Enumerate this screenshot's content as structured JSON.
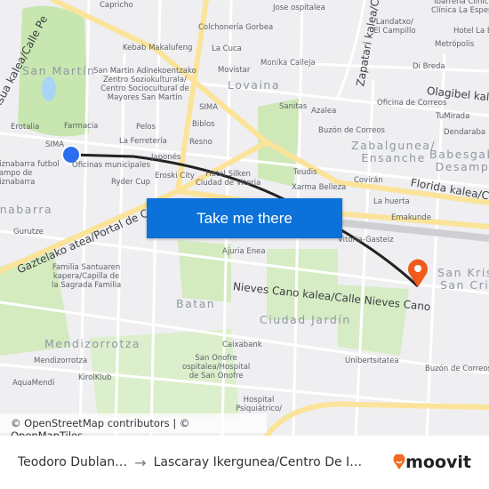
{
  "map": {
    "cta_label": "Take me there",
    "attribution": "© OpenStreetMap contributors | © OpenMapTiles",
    "districts": [
      "San Martín",
      "Lovaina",
      "Zabalgunea/\nEnsanche",
      "Babesgabe\nDesampa",
      "Ariznabarra",
      "Batan",
      "Ciudad Jardín",
      "Mendizorrotza",
      "San Krist\nSan Cris"
    ],
    "streets": [
      "Asua kalea/Calle Pe",
      "Zapatari kalea/C",
      "Olagibel kalea",
      "Florida kalea/Ca",
      "Gaztelako atea/Portal de Castilla",
      "Nieves Cano kalea/Calle Nieves Cano"
    ],
    "pois": [
      "Capricho",
      "Colchonería Gorbea",
      "Kebab Makalufeng",
      "La Cuca",
      "Movistar",
      "San Martin Adinekoentzako\nZentro Soziokulturala/\nCentro Sociocultural de\nMayores San Martín",
      "SIMA",
      "Biblos",
      "Pelos",
      "Farmacia",
      "Erotalia",
      "La Ferretería",
      "Resno",
      "SIMA",
      "Oficinas municipales",
      "Japonés",
      "Eroski City",
      "Hotel Silken\nCiudad de Vitoria",
      "Ryder Cup",
      "Gurutze",
      "Jose ospitalea",
      "Landatxo/\nEl Campillo",
      "Metrópolis",
      "Di Breda",
      "Monika Calleja",
      "Sanitas",
      "Azalea",
      "Oficina de Correos",
      "TuMirada",
      "Buzón de Correos",
      "Dendaraba",
      "Teudis",
      "Xarma Belleza",
      "Covirán",
      "La huerta",
      "Emakunde",
      "Vitoria-Gasteiz",
      "Ajuria Enea",
      "Familia Santuaren\nkapera/Capilla de\nla Sagrada Familia",
      "Caixabank",
      "San Onofre\nospitalea/Hospital\nde San Onofre",
      "Mendizorrotza",
      "KirolKlub",
      "AquaMendi",
      "Unibertsitatea",
      "Buzón de Correos",
      "Hospital\nPsiquiátrico/",
      "Ariznabarra futbol\n/Campo de\nAriznabarra",
      "Ibarrena Clínica\nClínica La Espera",
      "Hotel La Bi"
    ]
  },
  "route": {
    "origin_color": "#2b6ff0",
    "destination_color": "#f05a1c",
    "line_color": "#222222"
  },
  "footer": {
    "origin": "Teodoro Dublan…",
    "arrow": "→",
    "destination": "Lascaray Ikergunea/Centro De I…",
    "brand": "moovit",
    "brand_color": "#f06b22"
  }
}
